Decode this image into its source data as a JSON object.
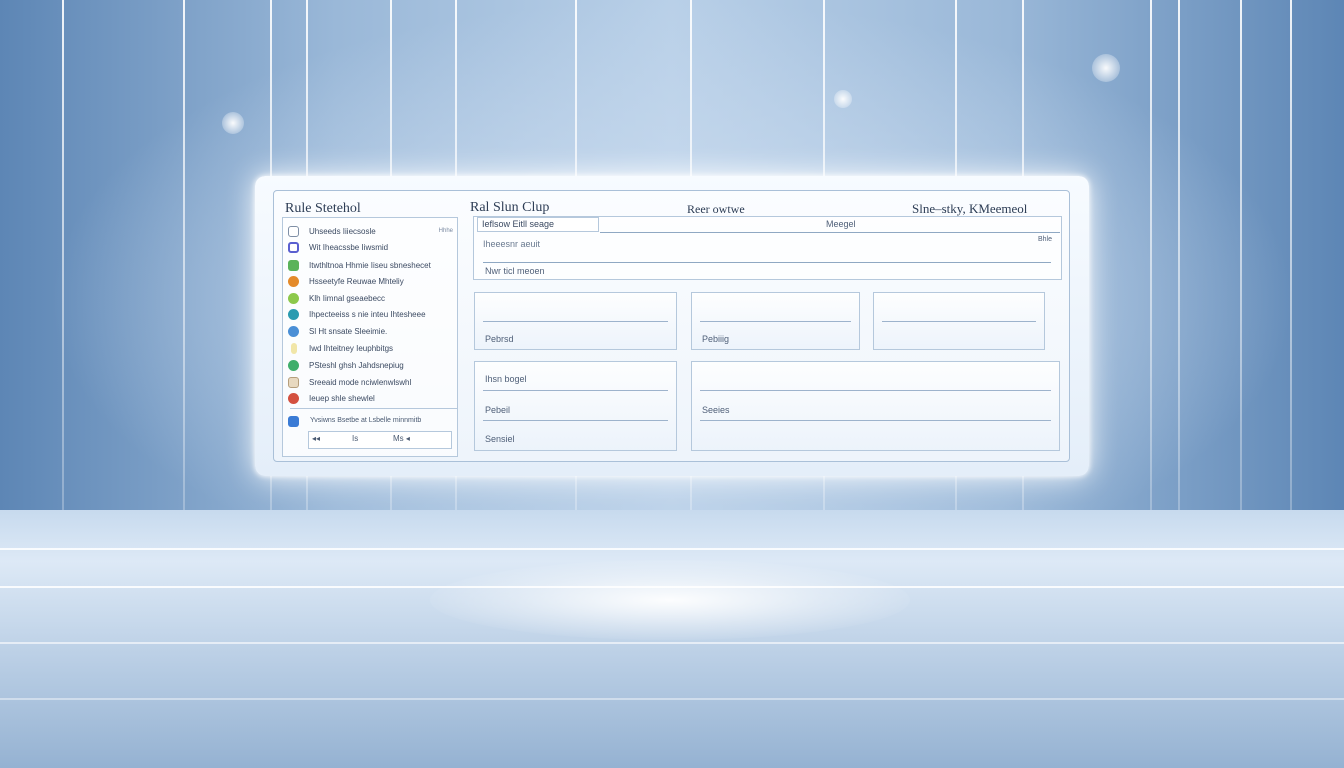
{
  "header": {
    "left_title": "Rule Stetehol",
    "center_title": "Ral Slun Clup",
    "review": "Reer owtwe",
    "right": "Slne–stky, KMeemeol"
  },
  "sidebar": {
    "items": [
      {
        "label": "Uhseeds Iiiecsosle",
        "badge": "Hhhe",
        "icon": "document-icon",
        "color": "#7f8fa6"
      },
      {
        "label": "Wit Iheacssbe Iiwsmid",
        "badge": "",
        "icon": "square-icon",
        "color": "#5a5fd0"
      },
      {
        "label": "Itwthltnoa Hhmie Iiseu sbneshecet",
        "badge": "",
        "icon": "circle-green-icon",
        "color": "#5ab35a"
      },
      {
        "label": "Hsseetyfe Reuwae Mhteliy",
        "badge": "",
        "icon": "circle-orange-icon",
        "color": "#e48a2a"
      },
      {
        "label": "Klh Iimnal gseaebecc",
        "badge": "",
        "icon": "leaf-icon",
        "color": "#8cc84b"
      },
      {
        "label": "Ihpecteeiss s nie inteu Ihtesheee",
        "badge": "",
        "icon": "circle-teal-icon",
        "color": "#2a9bb0"
      },
      {
        "label": "Sl Ht snsate Sleeimie.",
        "badge": "",
        "icon": "circle-blue-icon",
        "color": "#4a8fd6"
      },
      {
        "label": "Iwd Ihteitney Ieuphbitgs",
        "badge": "",
        "icon": "bar-icon",
        "color": "#f1e6a8"
      },
      {
        "label": "PSteshl ghsh Jahdsnepiug",
        "badge": "",
        "icon": "circle-green2-icon",
        "color": "#3fae6b"
      },
      {
        "label": "Sreeaid mode nciwlenwlswhl",
        "badge": "",
        "icon": "box-icon",
        "color": "#e8d9c0"
      },
      {
        "label": "Ieuep shle shewlel",
        "badge": "",
        "icon": "circle-red-icon",
        "color": "#d3503f"
      },
      {
        "label": "",
        "badge": "",
        "icon": "square-blue-icon",
        "color": "#3a7bd5"
      }
    ],
    "footer_text": "Yvsiwns Bsetbe at Lsbelle minnmitb",
    "controls": {
      "prev": "◂◂",
      "mid": "Is",
      "next": "Ms ◂"
    }
  },
  "top_field": {
    "tab": "Ieflsow Eitll seage",
    "right_label": "Meegel",
    "line1": "Iheeesnr aeuit",
    "line1_badge": "Bhle",
    "line2": "Nwr ticl meoen"
  },
  "cards": {
    "a_label": "Pebrsd",
    "b_label": "Pebiiig",
    "c_label": "",
    "d_label1": "Ihsn bogel",
    "d_label2": "Pebeil",
    "d_label3": "Sensiel",
    "e_label": "Seeies"
  }
}
